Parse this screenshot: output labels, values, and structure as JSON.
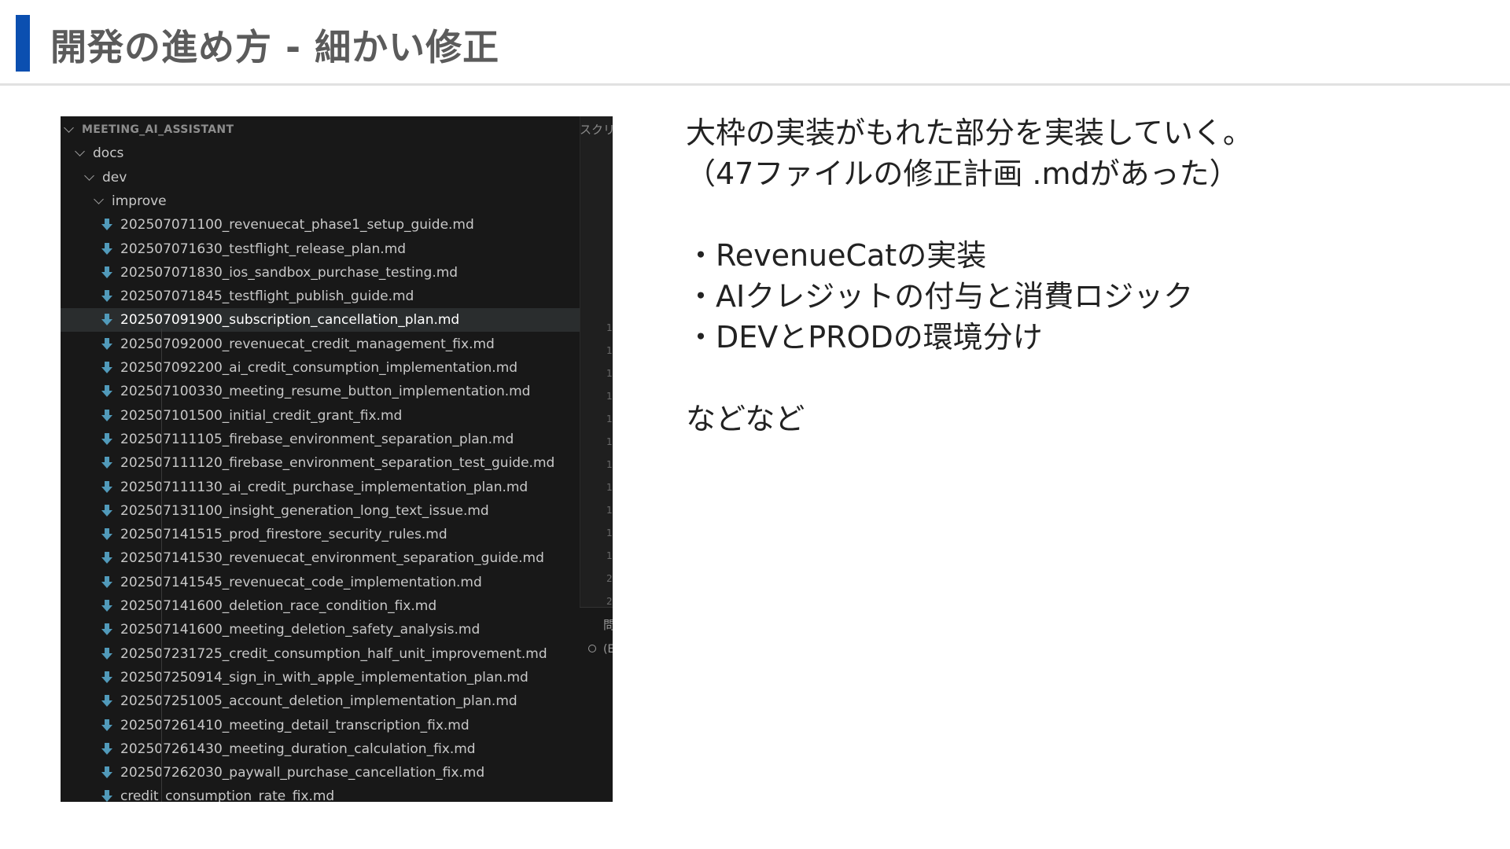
{
  "slide": {
    "title": "開発の進め方 - 細かい修正",
    "accent_color": "#0b4fb0"
  },
  "explorer": {
    "root": "MEETING_AI_ASSISTANT",
    "folders": [
      "docs",
      "dev",
      "improve"
    ],
    "files": [
      "202507071100_revenuecat_phase1_setup_guide.md",
      "202507071630_testflight_release_plan.md",
      "202507071830_ios_sandbox_purchase_testing.md",
      "202507071845_testflight_publish_guide.md",
      "202507091900_subscription_cancellation_plan.md",
      "202507092000_revenuecat_credit_management_fix.md",
      "202507092200_ai_credit_consumption_implementation.md",
      "202507100330_meeting_resume_button_implementation.md",
      "202507101500_initial_credit_grant_fix.md",
      "202507111105_firebase_environment_separation_plan.md",
      "202507111120_firebase_environment_separation_test_guide.md",
      "202507111130_ai_credit_purchase_implementation_plan.md",
      "202507131100_insight_generation_long_text_issue.md",
      "202507141515_prod_firestore_security_rules.md",
      "202507141530_revenuecat_environment_separation_guide.md",
      "202507141545_revenuecat_code_implementation.md",
      "202507141600_deletion_race_condition_fix.md",
      "202507141600_meeting_deletion_safety_analysis.md",
      "202507231725_credit_consumption_half_unit_improvement.md",
      "202507250914_sign_in_with_apple_implementation_plan.md",
      "202507251005_account_deletion_implementation_plan.md",
      "202507261410_meeting_detail_transcription_fix.md",
      "202507261430_meeting_duration_calculation_fix.md",
      "202507262030_paywall_purchase_cancellation_fix.md",
      "credit_consumption_rate_fix.md"
    ],
    "selected_file": "202507091900_subscription_cancellation_plan.md",
    "md_icon_color": "#519aba"
  },
  "side_panel": {
    "top_text": "スクリ",
    "line_numbers": [
      "1",
      "1",
      "1",
      "1",
      "1",
      "1",
      "1",
      "1",
      "1",
      "1",
      "1",
      "2",
      "2",
      "2",
      "2",
      "2"
    ],
    "tab_text": "問",
    "item_text": "(E"
  },
  "body": {
    "lines": [
      "大枠の実装がもれた部分を実装していく。",
      "（47ファイルの修正計画 .mdがあった）",
      "",
      "・RevenueCatの実装",
      "・AIクレジットの付与と消費ロジック",
      "・DEVとPRODの環境分け",
      "",
      "などなど"
    ]
  }
}
